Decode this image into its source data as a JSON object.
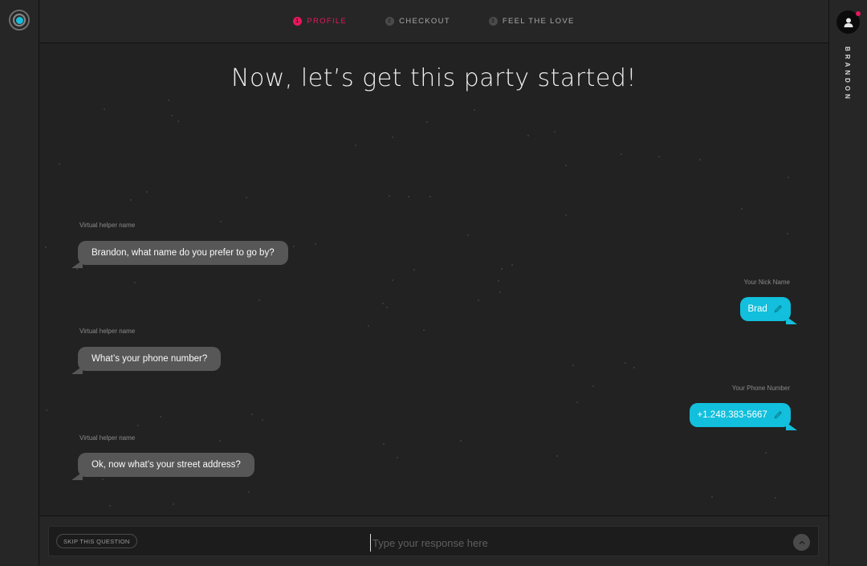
{
  "app": {
    "accent": "#e8175d",
    "bubble_color": "#12bfdc"
  },
  "nav": {
    "steps": [
      {
        "num": "1",
        "label": "PROFILE"
      },
      {
        "num": "2",
        "label": "CHECKOUT"
      },
      {
        "num": "3",
        "label": "FEEL THE LOVE"
      }
    ]
  },
  "user": {
    "name": "BRANDON"
  },
  "main": {
    "headline": "Now, let’s get this party started!"
  },
  "conversation": [
    {
      "label": "Virtual helper name",
      "text": "Brandon, what name do you prefer to go by?"
    },
    {
      "label": "Your Nick Name",
      "text": "Brad"
    },
    {
      "label": "Virtual helper name",
      "text": "What’s your phone number?"
    },
    {
      "label": "Your Phone Number",
      "text": "+1.248.383-5667"
    },
    {
      "label": "Virtual helper name",
      "text": "Ok, now what’s your street address?"
    }
  ],
  "input": {
    "skip_label": "SKIP THIS QUESTION",
    "placeholder": "Type your response here"
  }
}
